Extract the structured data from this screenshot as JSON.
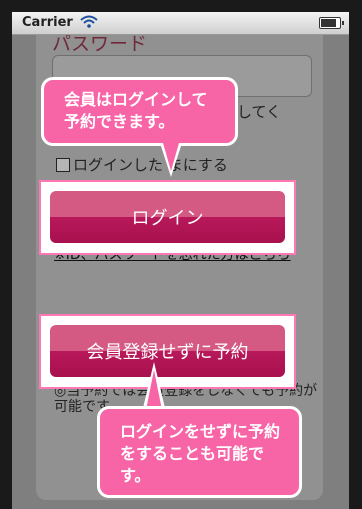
{
  "status_bar": {
    "carrier": "Carrier"
  },
  "form": {
    "password_label": "パスワード",
    "remember_partial": "カしてく",
    "checkbox_label": "ログインした  まにする",
    "login_button": "ログイン",
    "forgot_link": "※ID、パスワードを忘れた方はこちら",
    "guest_button": "会員登録せずに予約",
    "guest_note": "◎当予約では会員登録をしなくても予約が可能です。"
  },
  "callouts": {
    "login_tip": "会員はログインして予約できます。",
    "guest_tip": "ログインをせずに予約をすることも可能です。"
  },
  "colors": {
    "accent_pink": "#f765a7",
    "button_top": "#d45a84",
    "button_bottom": "#b8195a"
  }
}
